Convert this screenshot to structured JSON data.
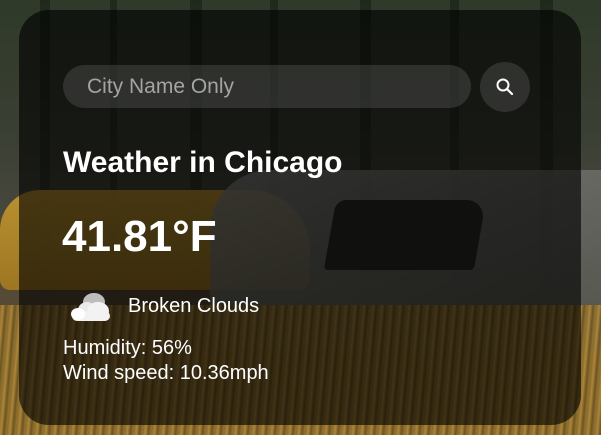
{
  "search": {
    "placeholder": "City Name Only",
    "value": "",
    "button_icon": "search-icon"
  },
  "weather": {
    "title": "Weather in Chicago",
    "temperature": "41.81°F",
    "condition_icon": "broken-clouds-icon",
    "description": "Broken Clouds",
    "humidity": "Humidity: 56%",
    "wind_speed": "Wind speed: 10.36mph"
  },
  "colors": {
    "card_background": "#000000",
    "text": "#ffffff",
    "input_background": "#787878",
    "placeholder": "#a4a4a4"
  }
}
